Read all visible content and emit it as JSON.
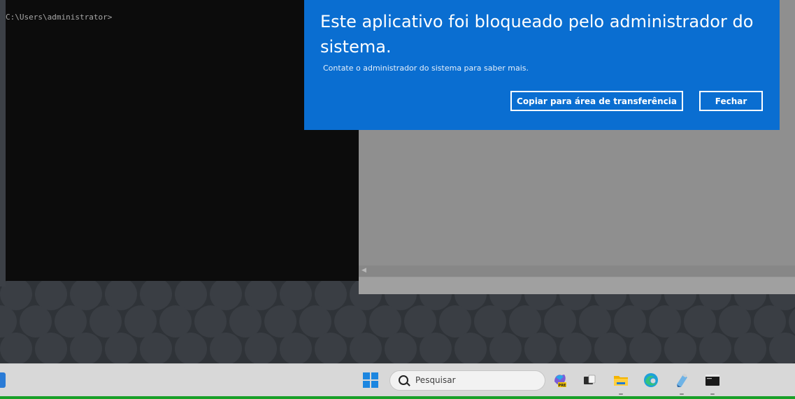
{
  "console": {
    "prompt": "C:\\Users\\administrator>"
  },
  "dialog": {
    "title": "Este aplicativo foi bloqueado pelo administrador do sistema.",
    "message": "Contate o administrador do sistema para saber mais.",
    "copy_button_label": "Copiar para área de transferência",
    "close_button_label": "Fechar"
  },
  "taskbar": {
    "search_placeholder": "Pesquisar",
    "apps": [
      {
        "icon": "copilot-pre-icon"
      },
      {
        "icon": "task-view-icon"
      },
      {
        "icon": "file-explorer-icon"
      },
      {
        "icon": "edge-browser-icon"
      },
      {
        "icon": "notepad-icon"
      },
      {
        "icon": "command-prompt-icon"
      }
    ]
  },
  "colors": {
    "dialog_background": "#0a6ed1",
    "console_background": "#0c0c0c",
    "taskbar_background": "#d8d8d8",
    "taskbar_accent_line": "#18a028"
  }
}
